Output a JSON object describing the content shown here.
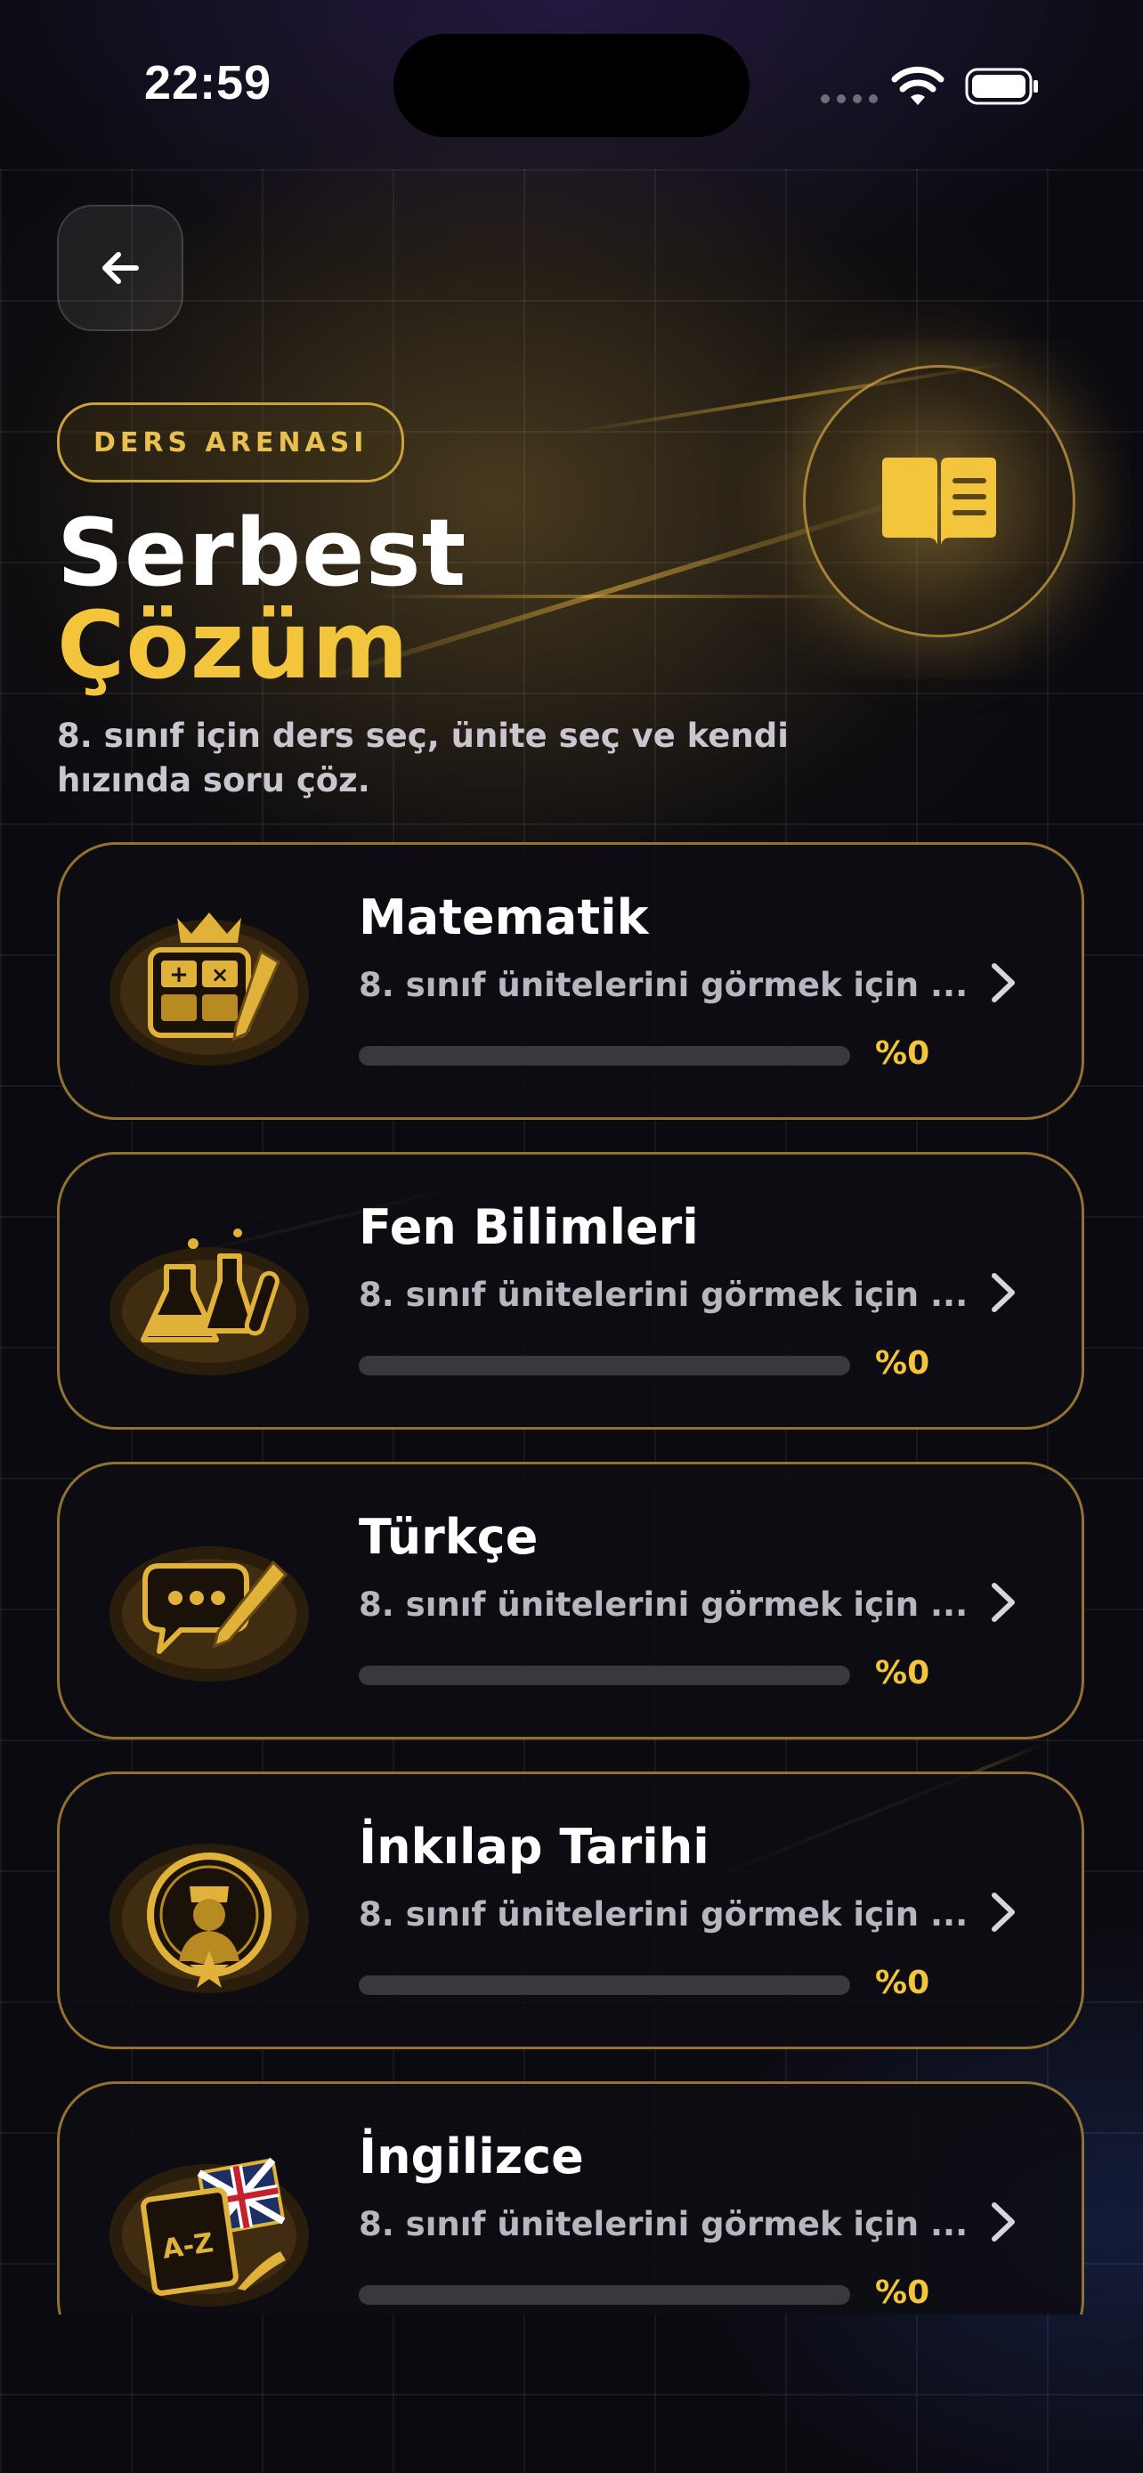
{
  "status": {
    "time": "22:59",
    "icons": [
      "cellular-signal-icon",
      "wifi-icon",
      "battery-icon"
    ]
  },
  "header": {
    "back_icon": "arrow-left-icon",
    "badge": "DERS ARENASI",
    "title_line1": "Serbest",
    "title_line2": "Çözüm",
    "subtitle": "8. sınıf için ders seç, ünite seç ve kendi hızında soru çöz.",
    "hero_icon": "open-book-icon"
  },
  "colors": {
    "accent": "#f3c53d",
    "card_border": "#be963c",
    "background": "#0b0a10"
  },
  "subjects": [
    {
      "name": "Matematik",
      "description": "8. sınıf ünitelerini görmek için ...",
      "progress_label": "%0",
      "progress": 0,
      "icon": "calculator-crown-icon"
    },
    {
      "name": "Fen Bilimleri",
      "description": "8. sınıf ünitelerini görmek için ...",
      "progress_label": "%0",
      "progress": 0,
      "icon": "lab-flasks-icon"
    },
    {
      "name": "Türkçe",
      "description": "8. sınıf ünitelerini görmek için ...",
      "progress_label": "%0",
      "progress": 0,
      "icon": "speech-bubble-pen-icon"
    },
    {
      "name": "İnkılap Tarihi",
      "description": "8. sınıf ünitelerini görmek için ...",
      "progress_label": "%0",
      "progress": 0,
      "icon": "medallion-portrait-icon"
    },
    {
      "name": "İngilizce",
      "description": "8. sınıf ünitelerini görmek için ...",
      "progress_label": "%0",
      "progress": 0,
      "icon": "dictionary-flag-icon"
    }
  ]
}
